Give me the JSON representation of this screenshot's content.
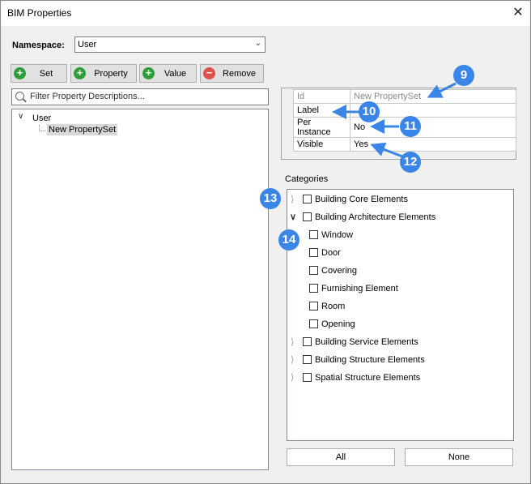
{
  "window": {
    "title": "BIM Properties",
    "close": "✕"
  },
  "namespace": {
    "label": "Namespace:",
    "value": "User"
  },
  "toolbar": {
    "set": "Set",
    "property": "Property",
    "value": "Value",
    "remove": "Remove"
  },
  "filter": {
    "placeholder": "Filter Property Descriptions..."
  },
  "tree": {
    "root": "User",
    "child": "New PropertySet"
  },
  "properties": {
    "rows": [
      {
        "key": "Id",
        "value": "New PropertySet"
      },
      {
        "key": "Label",
        "value": ""
      },
      {
        "key": "Per Instance",
        "value": "No"
      },
      {
        "key": "Visible",
        "value": "Yes"
      }
    ]
  },
  "categories": {
    "label": "Categories",
    "items": [
      {
        "label": "Building Core Elements"
      },
      {
        "label": "Building Architecture Elements"
      },
      {
        "label": "Window"
      },
      {
        "label": "Door"
      },
      {
        "label": "Covering"
      },
      {
        "label": "Furnishing Element"
      },
      {
        "label": "Room"
      },
      {
        "label": "Opening"
      },
      {
        "label": "Building Service Elements"
      },
      {
        "label": "Building Structure Elements"
      },
      {
        "label": "Spatial Structure Elements"
      }
    ]
  },
  "buttons": {
    "all": "All",
    "none": "None"
  },
  "callouts": [
    "9",
    "10",
    "11",
    "12",
    "13",
    "14"
  ],
  "colors": {
    "callout": "#3a86e8",
    "add_icon": "#2e9e3a",
    "remove_icon": "#e0504a"
  }
}
